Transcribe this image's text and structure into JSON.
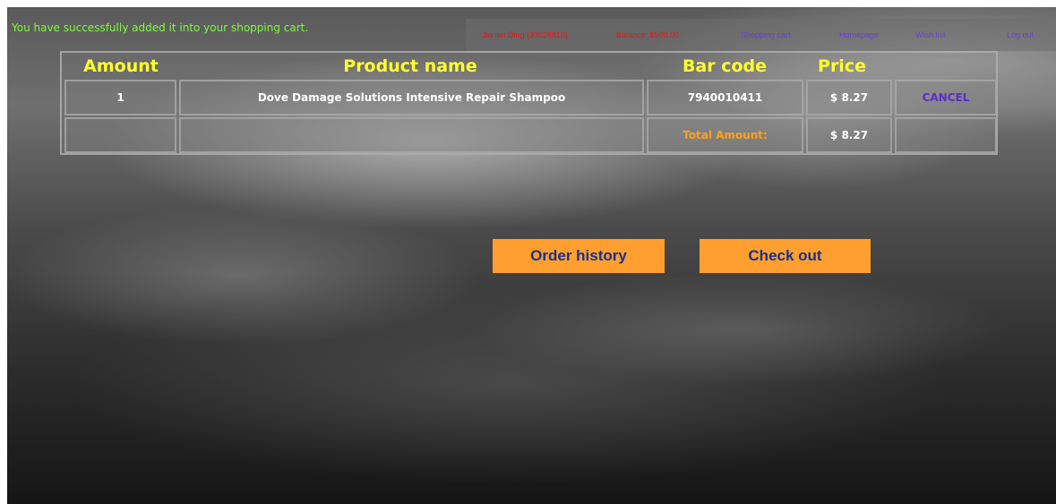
{
  "notice": {
    "message": "You have successfully added it into your shopping cart."
  },
  "nav": {
    "user": "Jianan Ding (33026810)",
    "balance": "Balance: $500.00",
    "shopping_cart": "Shopping cart",
    "homepage": "Homepage",
    "wish_list": "Wish list",
    "log_out": "Log out"
  },
  "cart": {
    "headers": {
      "amount": "Amount",
      "product_name": "Product name",
      "bar_code": "Bar code",
      "price": "Price"
    },
    "rows": [
      {
        "amount": "1",
        "product_name": "Dove Damage Solutions Intensive Repair Shampoo",
        "bar_code": "7940010411",
        "price": "$ 8.27",
        "action": "CANCEL"
      }
    ],
    "total": {
      "label": "Total Amount:",
      "value": "$ 8.27"
    }
  },
  "buttons": {
    "order_history": "Order history",
    "check_out": "Check out"
  },
  "colors": {
    "notice": "#7cfc3a",
    "header_text": "#ffff2e",
    "nav_alert": "#e01b1b",
    "nav_link": "#6a3fd2",
    "total_label": "#ffa21a",
    "button_bg": "#ff9f30",
    "button_text": "#1b2f8a"
  }
}
